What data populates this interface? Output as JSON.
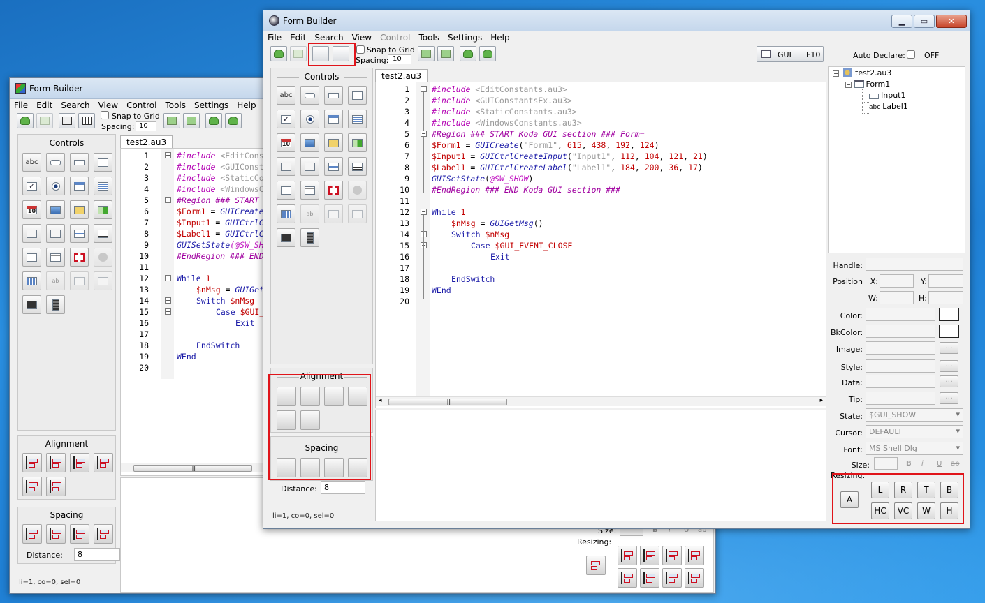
{
  "app": {
    "title": "Form Builder"
  },
  "menu": [
    "File",
    "Edit",
    "Search",
    "View",
    "Control",
    "Tools",
    "Settings",
    "Help"
  ],
  "toolbar": {
    "snap_label": "Snap to Grid",
    "spacing_label": "Spacing:",
    "spacing_value": "10",
    "gui_label": "GUI",
    "gui_shortcut": "F10",
    "auto_declare_label": "Auto Declare:",
    "auto_declare_state": "OFF"
  },
  "panels": {
    "controls": "Controls",
    "alignment": "Alignment",
    "spacing": "Spacing",
    "distance_label": "Distance:",
    "distance_value": "8"
  },
  "editor": {
    "tab": "test2.au3",
    "line_numbers": [
      "1",
      "2",
      "3",
      "4",
      "5",
      "6",
      "7",
      "8",
      "9",
      "10",
      "11",
      "12",
      "13",
      "14",
      "15",
      "16",
      "17",
      "18",
      "19",
      "20"
    ],
    "lines": {
      "l1a": "#include ",
      "l1b": "<EditConstants.au3>",
      "l2a": "#include ",
      "l2b": "<GUIConstantsEx.au3>",
      "l3a": "#include ",
      "l3b": "<StaticConstants.au3>",
      "l4a": "#include ",
      "l4b": "<WindowsConstants.au3>",
      "l5": "#Region ### START Koda GUI section ### Form=",
      "l6a": "$Form1",
      "l6b": " = ",
      "l6c": "GUICreate",
      "l6d": "(",
      "l6e": "\"Form1\"",
      "l6f": ", ",
      "l6g": "615",
      "l6h": ", ",
      "l6i": "438",
      "l6j": ", ",
      "l6k": "192",
      "l6l": ", ",
      "l6m": "124",
      "l6n": ")",
      "l7a": "$Input1",
      "l7b": " = ",
      "l7c": "GUICtrlCreateInput",
      "l7d": "(",
      "l7e": "\"Input1\"",
      "l7f": ", ",
      "l7g": "112",
      "l7h": ", ",
      "l7i": "104",
      "l7j": ", ",
      "l7k": "121",
      "l7l": ", ",
      "l7m": "21",
      "l7n": ")",
      "l8a": "$Label1",
      "l8b": " = ",
      "l8c": "GUICtrlCreateLabel",
      "l8d": "(",
      "l8e": "\"Label1\"",
      "l8f": ", ",
      "l8g": "184",
      "l8h": ", ",
      "l8i": "200",
      "l8j": ", ",
      "l8k": "36",
      "l8l": ", ",
      "l8m": "17",
      "l8n": ")",
      "l9a": "GUISetState",
      "l9b": "(",
      "l9c": "@SW_SHOW",
      "l9d": ")",
      "l10": "#EndRegion ### END Koda GUI section ###",
      "l12a": "While",
      "l12b": " 1",
      "l13a": "$nMsg",
      "l13b": " = ",
      "l13c": "GUIGetMsg",
      "l13d": "()",
      "l14a": "Switch",
      "l14b": " $nMsg",
      "l15a": "Case",
      "l15b": " $GUI_EVENT_CLOSE",
      "l16": "Exit",
      "l18": "EndSwitch",
      "l19": "WEnd"
    },
    "back_lines": {
      "l1b": "<EditConsta",
      "l2b": "<GUIConsta",
      "l3b": "<StaticCo",
      "l4b": "<WindowsC",
      "l5": "#Region ### START ",
      "l6c": "GUICreate",
      "l7c": "GUICtrlC",
      "l8c": "GUICtrlC",
      "l9c": "(@SW_SH",
      "l10": "#EndRegion ### END",
      "l13c": "GUIGet",
      "l15b": " $GUI_"
    }
  },
  "status_text": "li=1, co=0, sel=0",
  "tree": {
    "file": "test2.au3",
    "form": "Form1",
    "input": "Input1",
    "label_prefix": "abc",
    "label": "Label1"
  },
  "properties": {
    "handle": "Handle:",
    "position": "Position",
    "x": "X:",
    "y": "Y:",
    "w": "W:",
    "h": "H:",
    "color": "Color:",
    "bkcolor": "BkColor:",
    "image": "Image:",
    "style": "Style:",
    "data": "Data:",
    "tip": "Tip:",
    "state": "State:",
    "state_value": "$GUI_SHOW",
    "cursor": "Cursor:",
    "cursor_value": "DEFAULT",
    "font": "Font:",
    "font_value": "MS Shell Dlg",
    "size": "Size:",
    "ellipsis": "...",
    "fmt_b": "B",
    "fmt_i": "i",
    "fmt_u": "U",
    "fmt_s": "ab"
  },
  "resizing": {
    "label": "Resizing:",
    "buttons": [
      "A",
      "L",
      "R",
      "T",
      "B",
      "HC",
      "VC",
      "W",
      "H"
    ]
  },
  "ctl_labels": {
    "abc": "abc",
    "ab": "ab",
    "cal": "10"
  },
  "colors": {
    "highlight_box": "#e0141a",
    "keyword": "#1c1ca8",
    "variable": "#c20000",
    "directive": "#b300b3"
  }
}
